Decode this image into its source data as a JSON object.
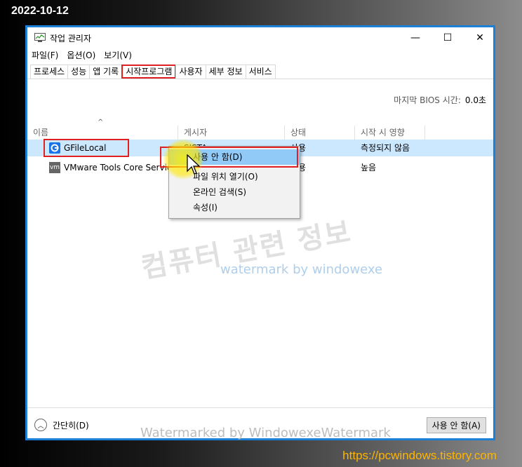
{
  "date": "2022-10-12",
  "window": {
    "title": "작업 관리자",
    "minimize": "—",
    "maximize": "☐",
    "close": "✕"
  },
  "menu": [
    "파일(F)",
    "옵션(O)",
    "보기(V)"
  ],
  "tabs": [
    "프로세스",
    "성능",
    "앱 기록",
    "시작프로그램",
    "사용자",
    "세부 정보",
    "서비스"
  ],
  "bios": {
    "label": "마지막 BIOS 시간:",
    "value": "0.0초"
  },
  "columns": [
    "이름",
    "게시자",
    "상태",
    "시작 시 영향"
  ],
  "sort_arrow": "^",
  "rows": [
    {
      "name": "GFileLocal",
      "publisher": "SISTA",
      "status": "사용",
      "impact": "측정되지 않음"
    },
    {
      "name": "VMware Tools Core Service",
      "publisher": "",
      "status": "사용",
      "impact": "높음"
    }
  ],
  "icons": {
    "row0": "gfile-icon",
    "row1": "vmware-icon",
    "vm_text": "vm"
  },
  "context_menu": [
    "사용 안 함(D)",
    "파일 위치 열기(O)",
    "온라인 검색(S)",
    "속성(I)"
  ],
  "watermarks": {
    "korean": "컴퓨터 관련 정보",
    "english": "watermark by windowexe",
    "bottom": "Watermarked by WindowexeWatermark"
  },
  "footer": {
    "fewer_details": "간단히(D)",
    "fewer_icon": "︿",
    "disable_button": "사용 안 함(A)"
  },
  "url": "https://pcwindows.tistory.com",
  "colors": {
    "accent_border": "#1e7fd8",
    "highlight_red": "#e02020",
    "selection": "#cce8ff",
    "url": "#ffb400"
  }
}
